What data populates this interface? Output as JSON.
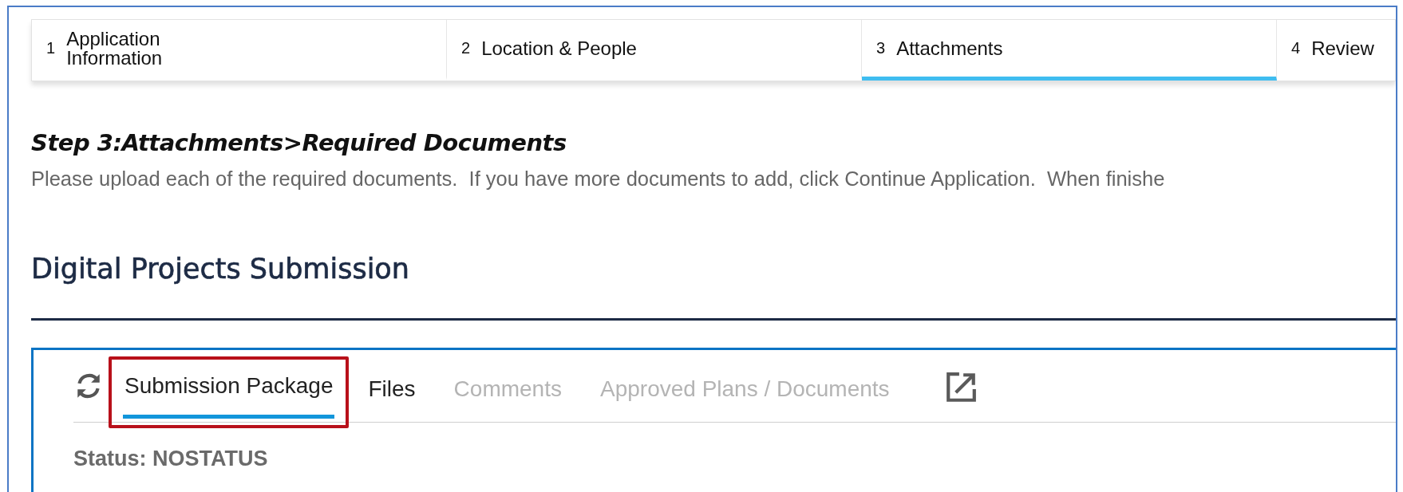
{
  "steps": [
    {
      "number": "1",
      "label": "Application Information",
      "selected": false
    },
    {
      "number": "2",
      "label": "Location & People",
      "selected": false
    },
    {
      "number": "3",
      "label": "Attachments",
      "selected": true
    },
    {
      "number": "4",
      "label": "Review",
      "selected": false
    }
  ],
  "heading": "Step 3:Attachments>Required Documents",
  "instructions": "Please upload each of the required documents.  If you have more documents to add, click Continue Application.  When finishe",
  "section_title": "Digital Projects Submission",
  "panel": {
    "tabs": [
      {
        "label": "Submission Package",
        "selected": true,
        "disabled": false,
        "highlighted": true
      },
      {
        "label": "Files",
        "selected": false,
        "disabled": false,
        "highlighted": false
      },
      {
        "label": "Comments",
        "selected": false,
        "disabled": true,
        "highlighted": false
      },
      {
        "label": "Approved Plans / Documents",
        "selected": false,
        "disabled": true,
        "highlighted": false
      }
    ],
    "status": "Status: NOSTATUS"
  }
}
